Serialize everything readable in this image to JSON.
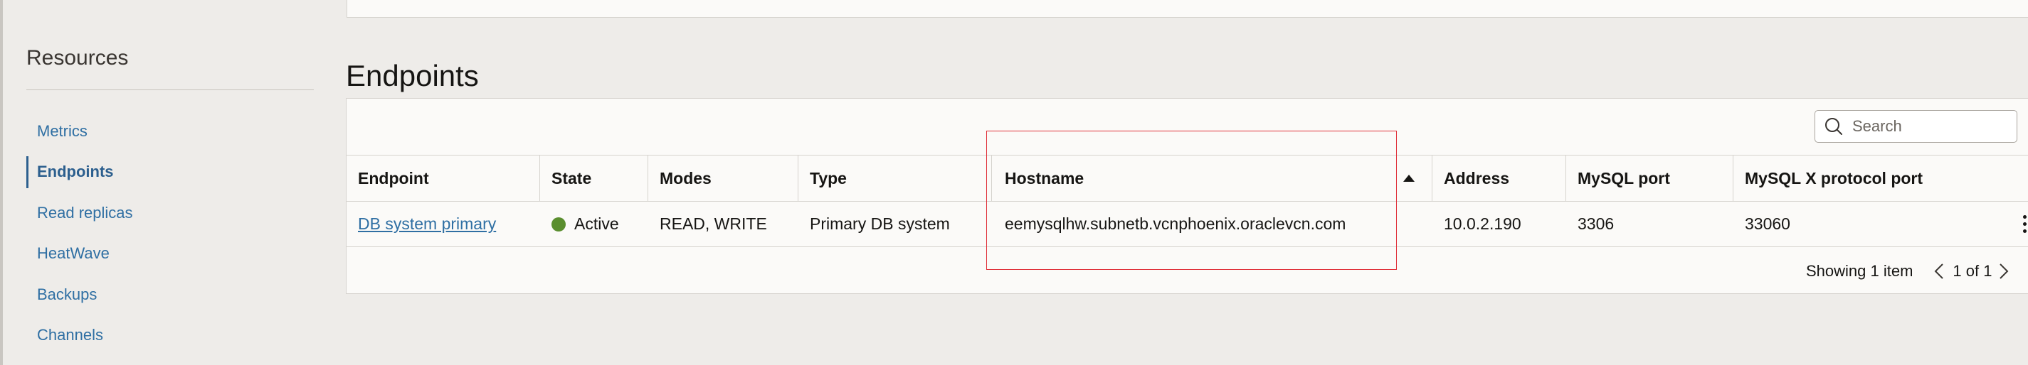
{
  "sidebar": {
    "title": "Resources",
    "items": [
      {
        "label": "Metrics",
        "active": false
      },
      {
        "label": "Endpoints",
        "active": true
      },
      {
        "label": "Read replicas",
        "active": false
      },
      {
        "label": "HeatWave",
        "active": false
      },
      {
        "label": "Backups",
        "active": false
      },
      {
        "label": "Channels",
        "active": false
      }
    ]
  },
  "main": {
    "title": "Endpoints",
    "search": {
      "placeholder": "Search",
      "value": ""
    },
    "table": {
      "columns": [
        "Endpoint",
        "State",
        "Modes",
        "Type",
        "Hostname",
        "Address",
        "MySQL port",
        "MySQL X protocol port"
      ],
      "sorted_column": "Hostname",
      "sort_direction": "ascending",
      "rows": [
        {
          "endpoint": "DB system primary",
          "state": "Active",
          "state_color": "#5a8e2e",
          "modes": "READ, WRITE",
          "type": "Primary DB system",
          "hostname": "eemysqlhw.subnetb.vcnphoenix.oraclevcn.com",
          "address": "10.0.2.190",
          "mysql_port": "3306",
          "mysql_x_port": "33060"
        }
      ]
    },
    "footer": {
      "showing": "Showing 1 item",
      "page_info": "1 of 1"
    }
  },
  "colors": {
    "link": "#2f6fa3",
    "highlight": "#e0303a",
    "active_status": "#5a8e2e"
  },
  "icons": {
    "search": "search-icon",
    "sort": "sort-ascending-icon",
    "actions": "kebab-menu-icon",
    "prev": "chevron-left-icon",
    "next": "chevron-right-icon"
  }
}
